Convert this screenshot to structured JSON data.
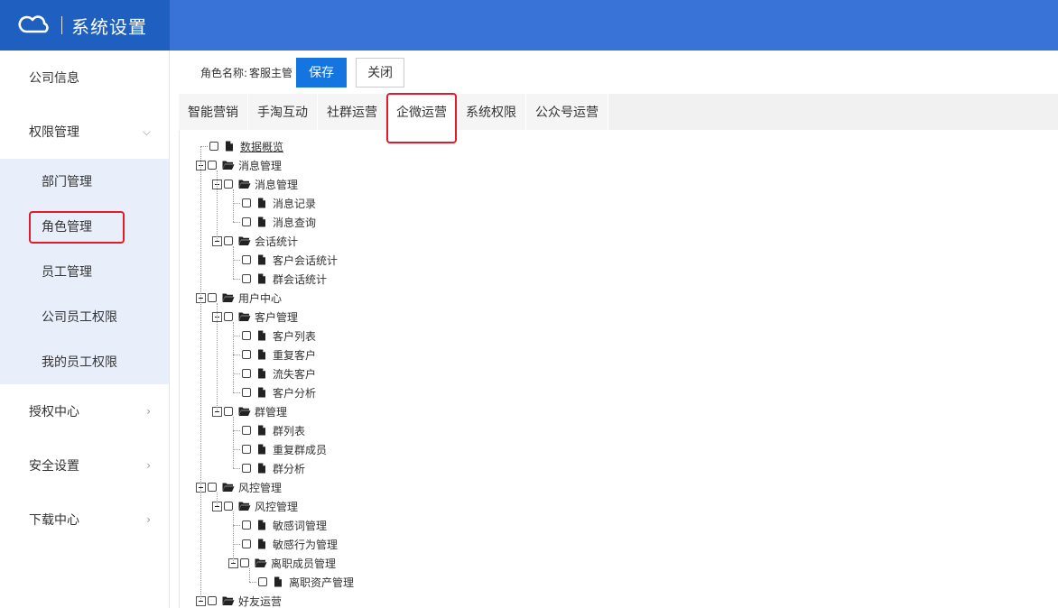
{
  "header": {
    "title": "系统设置"
  },
  "sidebar": {
    "items": [
      {
        "label": "公司信息"
      },
      {
        "label": "权限管理",
        "arrow": "⌵"
      },
      {
        "label": "授权中心",
        "arrow": "›"
      },
      {
        "label": "安全设置",
        "arrow": "›"
      },
      {
        "label": "下载中心",
        "arrow": "›"
      }
    ],
    "submenu": [
      {
        "label": "部门管理"
      },
      {
        "label": "角色管理"
      },
      {
        "label": "员工管理"
      },
      {
        "label": "公司员工权限"
      },
      {
        "label": "我的员工权限"
      }
    ]
  },
  "toolbar": {
    "role_label": "角色名称:",
    "role_value": "客服主管",
    "save_label": "保存",
    "close_label": "关闭"
  },
  "tabs": [
    {
      "label": "智能营销"
    },
    {
      "label": "手淘互动"
    },
    {
      "label": "社群运营"
    },
    {
      "label": "企微运营"
    },
    {
      "label": "系统权限"
    },
    {
      "label": "公众号运营"
    }
  ],
  "tree": [
    {
      "label": "数据概览",
      "level": 0,
      "type": "file",
      "underline": true
    },
    {
      "label": "消息管理",
      "level": 0,
      "type": "folder"
    },
    {
      "label": "消息管理",
      "level": 1,
      "type": "folder"
    },
    {
      "label": "消息记录",
      "level": 2,
      "type": "file"
    },
    {
      "label": "消息查询",
      "level": 2,
      "type": "file"
    },
    {
      "label": "会话统计",
      "level": 1,
      "type": "folder"
    },
    {
      "label": "客户会话统计",
      "level": 2,
      "type": "file"
    },
    {
      "label": "群会话统计",
      "level": 2,
      "type": "file"
    },
    {
      "label": "用户中心",
      "level": 0,
      "type": "folder"
    },
    {
      "label": "客户管理",
      "level": 1,
      "type": "folder"
    },
    {
      "label": "客户列表",
      "level": 2,
      "type": "file"
    },
    {
      "label": "重复客户",
      "level": 2,
      "type": "file"
    },
    {
      "label": "流失客户",
      "level": 2,
      "type": "file"
    },
    {
      "label": "客户分析",
      "level": 2,
      "type": "file"
    },
    {
      "label": "群管理",
      "level": 1,
      "type": "folder"
    },
    {
      "label": "群列表",
      "level": 2,
      "type": "file"
    },
    {
      "label": "重复群成员",
      "level": 2,
      "type": "file"
    },
    {
      "label": "群分析",
      "level": 2,
      "type": "file"
    },
    {
      "label": "风控管理",
      "level": 0,
      "type": "folder"
    },
    {
      "label": "风控管理",
      "level": 1,
      "type": "folder"
    },
    {
      "label": "敏感词管理",
      "level": 2,
      "type": "file"
    },
    {
      "label": "敏感行为管理",
      "level": 2,
      "type": "file"
    },
    {
      "label": "离职成员管理",
      "level": 2,
      "type": "folder"
    },
    {
      "label": "离职资产管理",
      "level": 3,
      "type": "file"
    },
    {
      "label": "好友运营",
      "level": 0,
      "type": "folder"
    }
  ]
}
